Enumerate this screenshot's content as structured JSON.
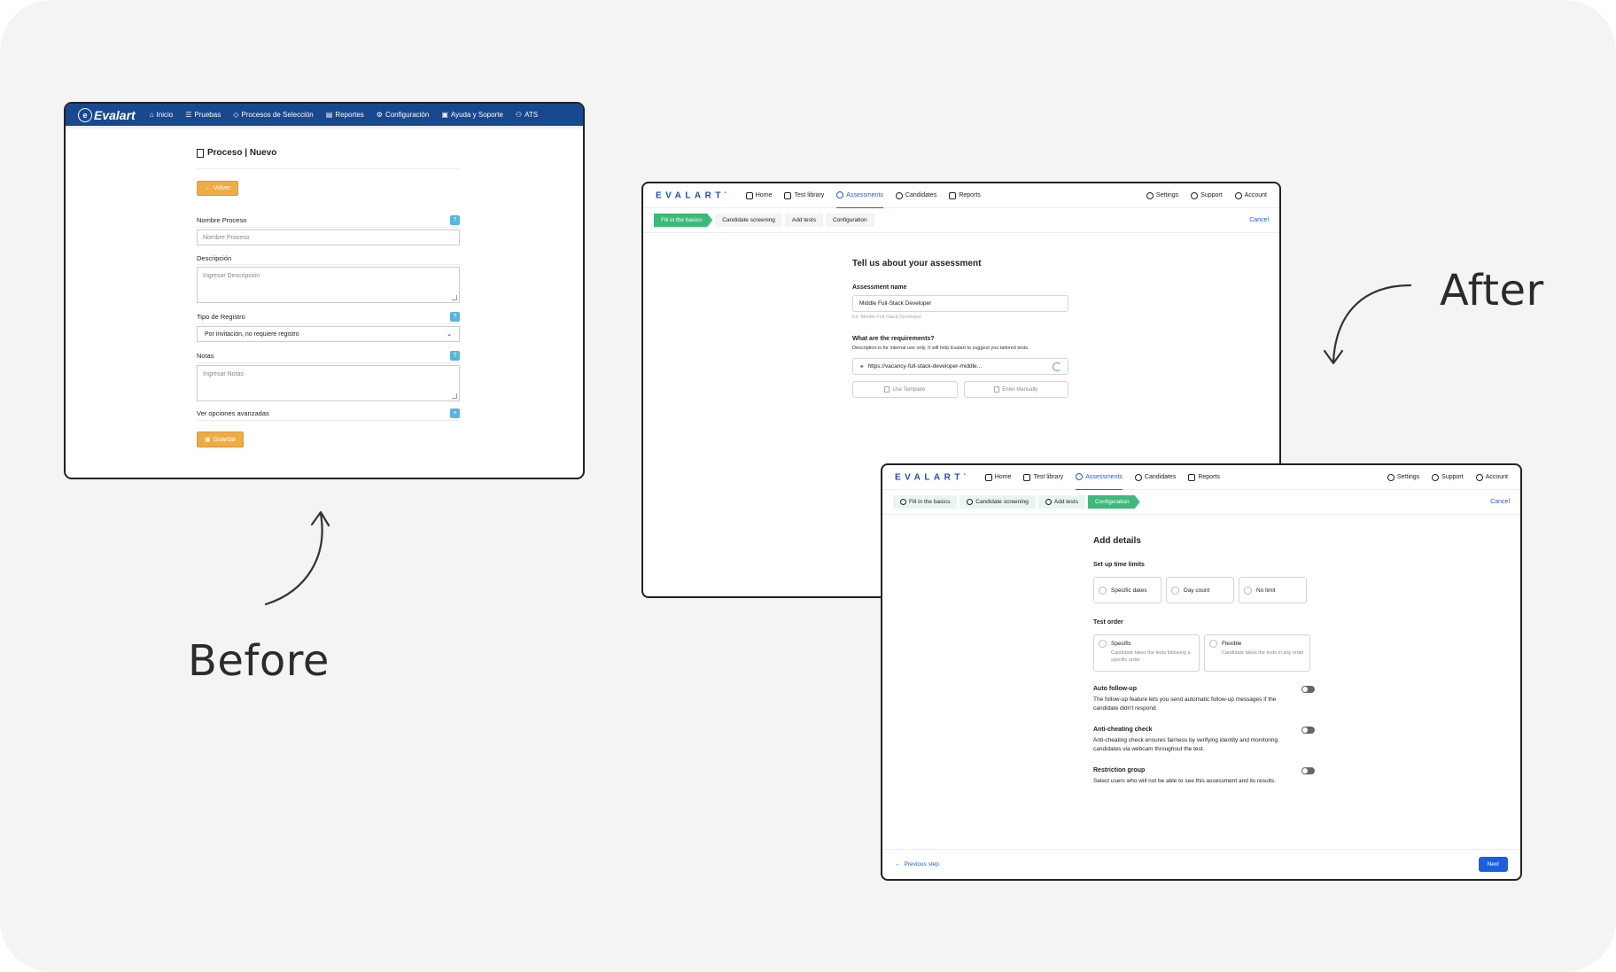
{
  "labels": {
    "before": "Before",
    "after": "After"
  },
  "before": {
    "logo": "Evalart",
    "nav": [
      "Inicio",
      "Pruebas",
      "Procesos de Selección",
      "Reportes",
      "Configuración",
      "Ayuda y Soporte",
      "ATS"
    ],
    "title": "Proceso | Nuevo",
    "back_button": "Volver",
    "fields": {
      "nombre_label": "Nombre Proceso",
      "nombre_placeholder": "Nombre Proceso",
      "descripcion_label": "Descripción",
      "descripcion_placeholder": "Ingresar Descripción",
      "tipo_label": "Tipo de Registro",
      "tipo_value": "Por invitación, no requiere registro",
      "notas_label": "Notas",
      "notas_placeholder": "Ingresar Notas",
      "avanzadas_label": "Ver opciones avanzadas"
    },
    "save_button": "Guardar"
  },
  "after": {
    "logo": "EVALART",
    "nav": {
      "home": "Home",
      "test_library": "Test library",
      "assessments": "Assessments",
      "candidates": "Candidates",
      "reports": "Reports",
      "settings": "Settings",
      "support": "Support",
      "account": "Account"
    },
    "steps": {
      "basics": "Fill in the basics",
      "screening": "Candidate screening",
      "add_tests": "Add tests",
      "configuration": "Configuration"
    },
    "cancel": "Cancel",
    "screen1": {
      "title": "Tell us about your assessment",
      "name_label": "Assessment name",
      "name_value": "Middle Full-Stack Developer",
      "name_hint": "Ex. Middle Full-Stack Developer",
      "req_label": "What are the requirements?",
      "req_desc": "Description is for internal use only. It will help Evalart to suggest you tailored tests.",
      "url_value": "https://vacancy-full-stack-developer-middle...",
      "use_template": "Use Template",
      "enter_manually": "Enter Manually"
    },
    "screen2": {
      "title": "Add details",
      "time_limits_label": "Set up time limits",
      "time_options": [
        "Specific dates",
        "Day count",
        "No limit"
      ],
      "order_label": "Test order",
      "order_specific": "Specific",
      "order_specific_desc": "Candidate takes the tests following a specific order",
      "order_flexible": "Flexible",
      "order_flexible_desc": "Candidate takes the tests in any order",
      "follow_up_title": "Auto follow-up",
      "follow_up_desc": "The follow-up feature lets you send automatic follow-up messages if the candidate didn't respond.",
      "anti_cheat_title": "Anti-cheating check",
      "anti_cheat_desc": "Anti-cheating check ensures fairness by verifying identity and monitoring candidates via webcam throughout the test.",
      "restriction_title": "Restriction group",
      "restriction_desc": "Select users who will not be able to see this assessment and its results.",
      "previous": "Previous step",
      "next": "Next"
    }
  }
}
